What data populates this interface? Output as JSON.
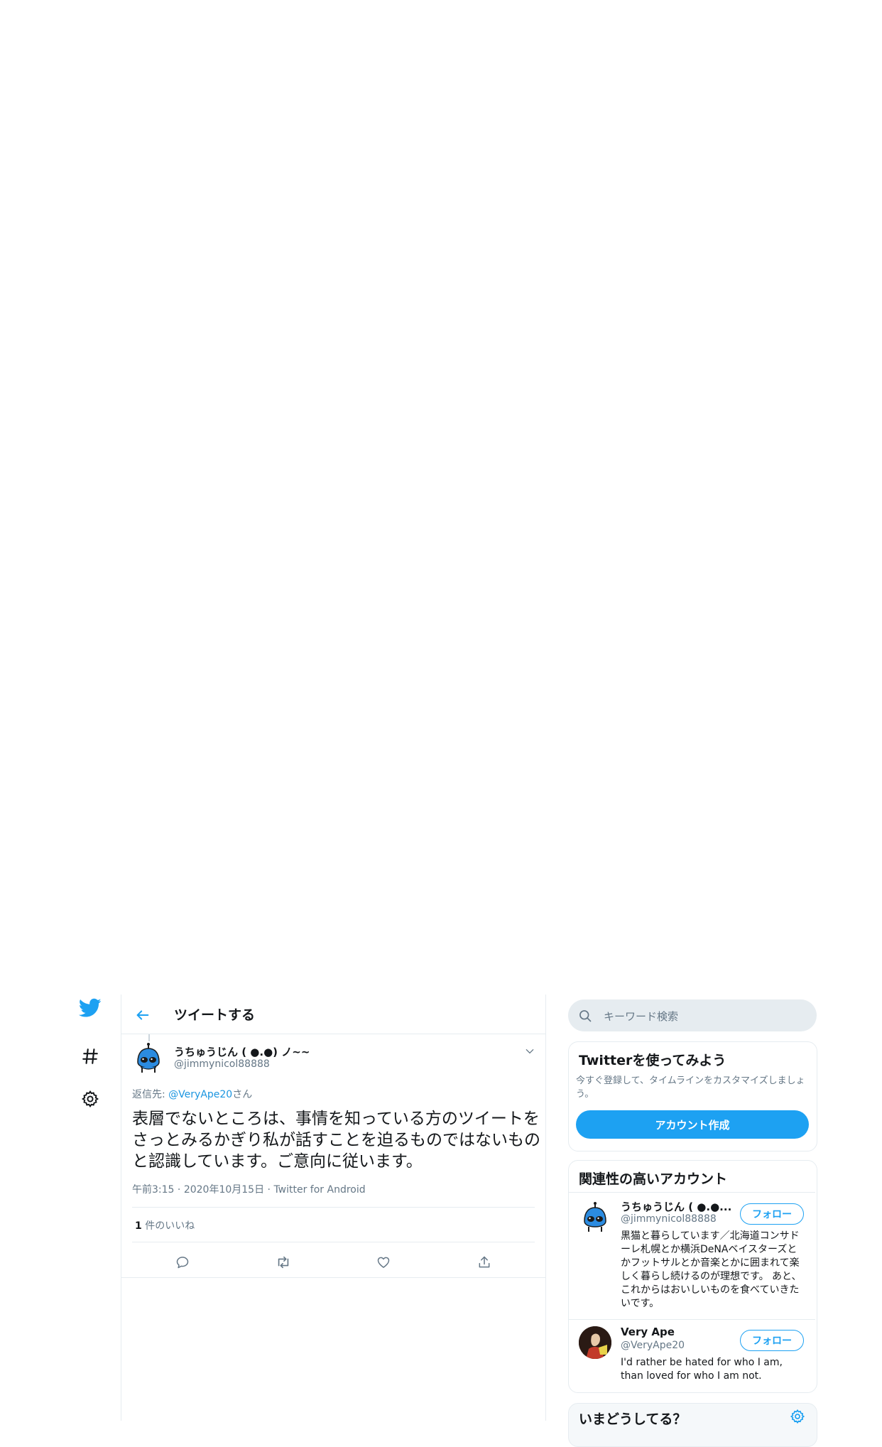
{
  "header": {
    "title": "ツイートする"
  },
  "tweet": {
    "display_name": "うちゅうじん ( ●.●) ノ~~",
    "handle": "@jimmynicol88888",
    "reply_to_prefix": "返信先:",
    "reply_to_mention": "@VeryApe20",
    "reply_to_suffix": "さん",
    "text": "表層でないところは、事情を知っている方のツイートをさっとみるかぎり私が話すことを迫るものではないものと認識しています。ご意向に従います。",
    "time": "午前3:15",
    "date": "2020年10月15日",
    "source": "Twitter for Android",
    "meta_sep": " · ",
    "likes_count": "1",
    "likes_label": " 件のいいね"
  },
  "search": {
    "placeholder": "キーワード検索"
  },
  "signup_card": {
    "title": "Twitterを使ってみよう",
    "description": "今すぐ登録して、タイムラインをカスタマイズしましょう。",
    "button": "アカウント作成"
  },
  "related": {
    "title": "関連性の高いアカウント",
    "accounts": [
      {
        "name": "うちゅうじん ( ●.●...",
        "handle": "@jimmynicol88888",
        "bio": "黒猫と暮らしています／北海道コンサドーレ札幌とか横浜DeNAベイスターズとかフットサルとか音楽とかに囲まれて楽しく暮らし続けるのが理想です。 あと、これからはおいしいものを食べていきたいです。",
        "follow": "フォロー"
      },
      {
        "name": "Very Ape",
        "handle": "@VeryApe20",
        "bio": "I'd rather be hated for who I am, than loved for who I am not.",
        "follow": "フォロー"
      }
    ]
  },
  "trends": {
    "title": "いまどうしてる？"
  },
  "colors": {
    "accent": "#1da1f2",
    "text": "#14171a",
    "muted": "#657786",
    "border": "#e6ecf0"
  },
  "icons": {
    "nav": [
      "twitter-bird-icon",
      "hashtag-icon",
      "gear-icon"
    ],
    "actions": [
      "reply-icon",
      "retweet-icon",
      "like-icon",
      "share-icon"
    ]
  }
}
